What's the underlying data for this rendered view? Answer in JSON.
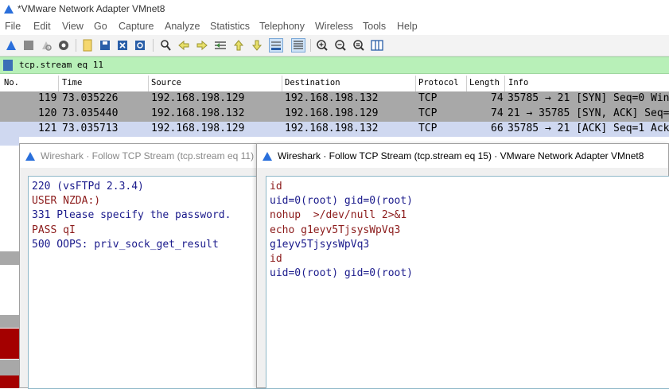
{
  "window": {
    "title": "*VMware Network Adapter VMnet8"
  },
  "menu": [
    "File",
    "Edit",
    "View",
    "Go",
    "Capture",
    "Analyze",
    "Statistics",
    "Telephony",
    "Wireless",
    "Tools",
    "Help"
  ],
  "toolbar": {
    "icons": [
      "start-capture-icon",
      "stop-capture-icon",
      "restart-capture-icon",
      "capture-options-icon",
      "open-file-icon",
      "save-file-icon",
      "close-file-icon",
      "reload-file-icon",
      "find-packet-icon",
      "go-back-icon",
      "go-forward-icon",
      "go-to-packet-icon",
      "first-packet-icon",
      "last-packet-icon",
      "auto-scroll-icon",
      "colorize-icon",
      "zoom-in-icon",
      "zoom-out-icon",
      "normal-size-icon",
      "resize-columns-icon"
    ]
  },
  "filter": {
    "value": "tcp.stream eq 11"
  },
  "packet_list": {
    "columns": [
      "No.",
      "Time",
      "Source",
      "Destination",
      "Protocol",
      "Length",
      "Info"
    ],
    "rows": [
      {
        "no": "119",
        "time": "73.035226",
        "src": "192.168.198.129",
        "dst": "192.168.198.132",
        "proto": "TCP",
        "len": "74",
        "info": "35785 → 21 [SYN] Seq=0 Win"
      },
      {
        "no": "120",
        "time": "73.035440",
        "src": "192.168.198.132",
        "dst": "192.168.198.129",
        "proto": "TCP",
        "len": "74",
        "info": "21 → 35785 [SYN, ACK] Seq="
      },
      {
        "no": "121",
        "time": "73.035713",
        "src": "192.168.198.129",
        "dst": "192.168.198.132",
        "proto": "TCP",
        "len": "66",
        "info": "35785 → 21 [ACK] Seq=1 Ack"
      }
    ]
  },
  "dialog_back": {
    "title": "Wireshark · Follow TCP Stream (tcp.stream eq 11) · V",
    "lines": [
      {
        "text": "220 (vsFTPd 2.3.4)",
        "dir": "server"
      },
      {
        "text": "USER NZDA:)",
        "dir": "client"
      },
      {
        "text": "331 Please specify the password.",
        "dir": "server"
      },
      {
        "text": "PASS qI",
        "dir": "client"
      },
      {
        "text": "500 OOPS: priv_sock_get_result",
        "dir": "server"
      }
    ]
  },
  "dialog_front": {
    "title": "Wireshark · Follow TCP Stream (tcp.stream eq 15) · VMware Network Adapter VMnet8",
    "lines": [
      {
        "text": "id",
        "dir": "client"
      },
      {
        "text": "uid=0(root) gid=0(root)",
        "dir": "server"
      },
      {
        "text": "nohup  >/dev/null 2>&1",
        "dir": "client"
      },
      {
        "text": "echo g1eyv5TjsysWpVq3",
        "dir": "client"
      },
      {
        "text": "g1eyv5TjsysWpVq3",
        "dir": "server"
      },
      {
        "text": "id",
        "dir": "client"
      },
      {
        "text": "uid=0(root) gid=0(root)",
        "dir": "server"
      }
    ]
  },
  "colors": {
    "client_text": "#8b1a1a",
    "server_text": "#1a1a8b",
    "filter_bg": "#b8f0b8",
    "selected_row": "#cfd8f0",
    "rst_row": "#a40000"
  }
}
